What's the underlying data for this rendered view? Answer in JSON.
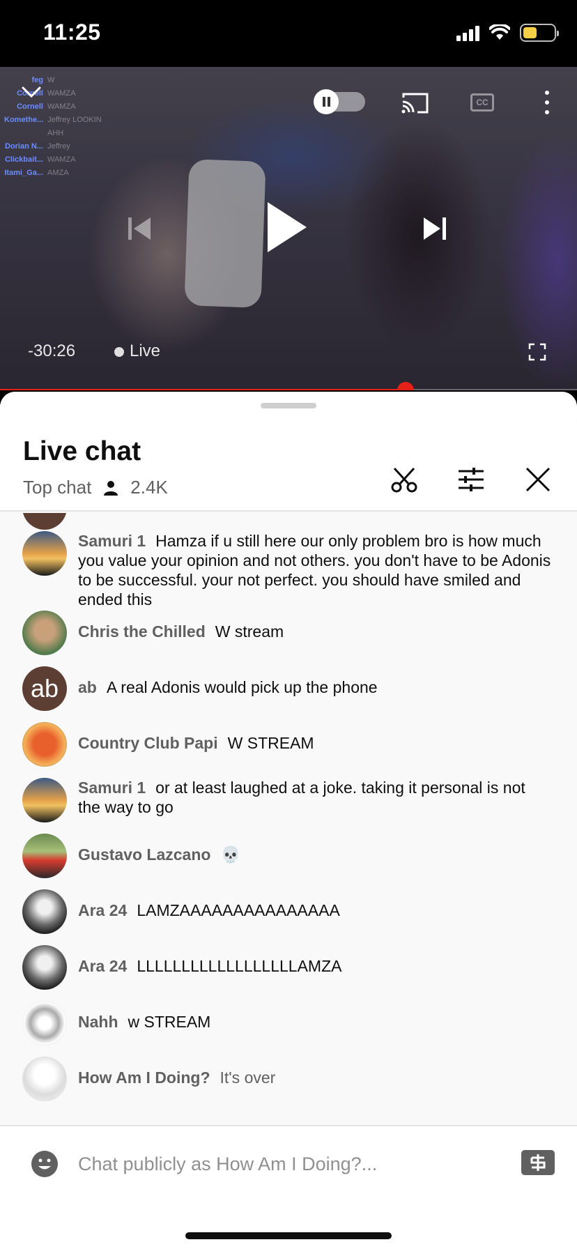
{
  "status_bar": {
    "time": "11:25",
    "battery_color": "#f3d046"
  },
  "player": {
    "elapsed": "-30:26",
    "live_label": "Live",
    "cc_label": "CC",
    "progress_fraction": 0.703,
    "accent": "#e62117",
    "overlay_chat": [
      {
        "name": "feg",
        "msg": "W"
      },
      {
        "name": "Cornell",
        "msg": "WAMZA"
      },
      {
        "name": "Cornell",
        "msg": "WAMZA"
      },
      {
        "name": "Komethe...",
        "msg": "Jeffrey LOOKIN"
      },
      {
        "name": "",
        "msg": "AHH"
      },
      {
        "name": "Dorian N...",
        "msg": "Jeffrey"
      },
      {
        "name": "Clickbait...",
        "msg": "WAMZA"
      },
      {
        "name": "Itami_Ga...",
        "msg": "AMZA"
      }
    ]
  },
  "chat": {
    "title": "Live chat",
    "mode": "Top chat",
    "viewers": "2.4K",
    "messages": [
      {
        "author": "Samuri 1",
        "text": "Hamza if u still here our only problem bro is how much you value your opinion and not others. you don't have to be Adonis to be successful. your not perfect. you should have smiled and ended this"
      },
      {
        "author": "Chris the Chilled",
        "text": "W stream"
      },
      {
        "author": "ab",
        "avatar_text": "ab",
        "text": "A real Adonis would pick up the phone"
      },
      {
        "author": "Country Club Papi",
        "text": "W STREAM"
      },
      {
        "author": "Samuri 1",
        "text": "or at least laughed at a joke. taking it personal is not the way to go"
      },
      {
        "author": "Gustavo Lazcano",
        "text": "💀"
      },
      {
        "author": "Ara 24",
        "text": "LAMZAAAAAAAAAAAAAAA"
      },
      {
        "author": "Ara 24",
        "text": "LLLLLLLLLLLLLLLLLLAMZA"
      },
      {
        "author": "Nahh",
        "text": "w STREAM"
      },
      {
        "author": "How Am I Doing?",
        "text": "It's over"
      }
    ],
    "input_placeholder": "Chat publicly as How Am I Doing?..."
  }
}
